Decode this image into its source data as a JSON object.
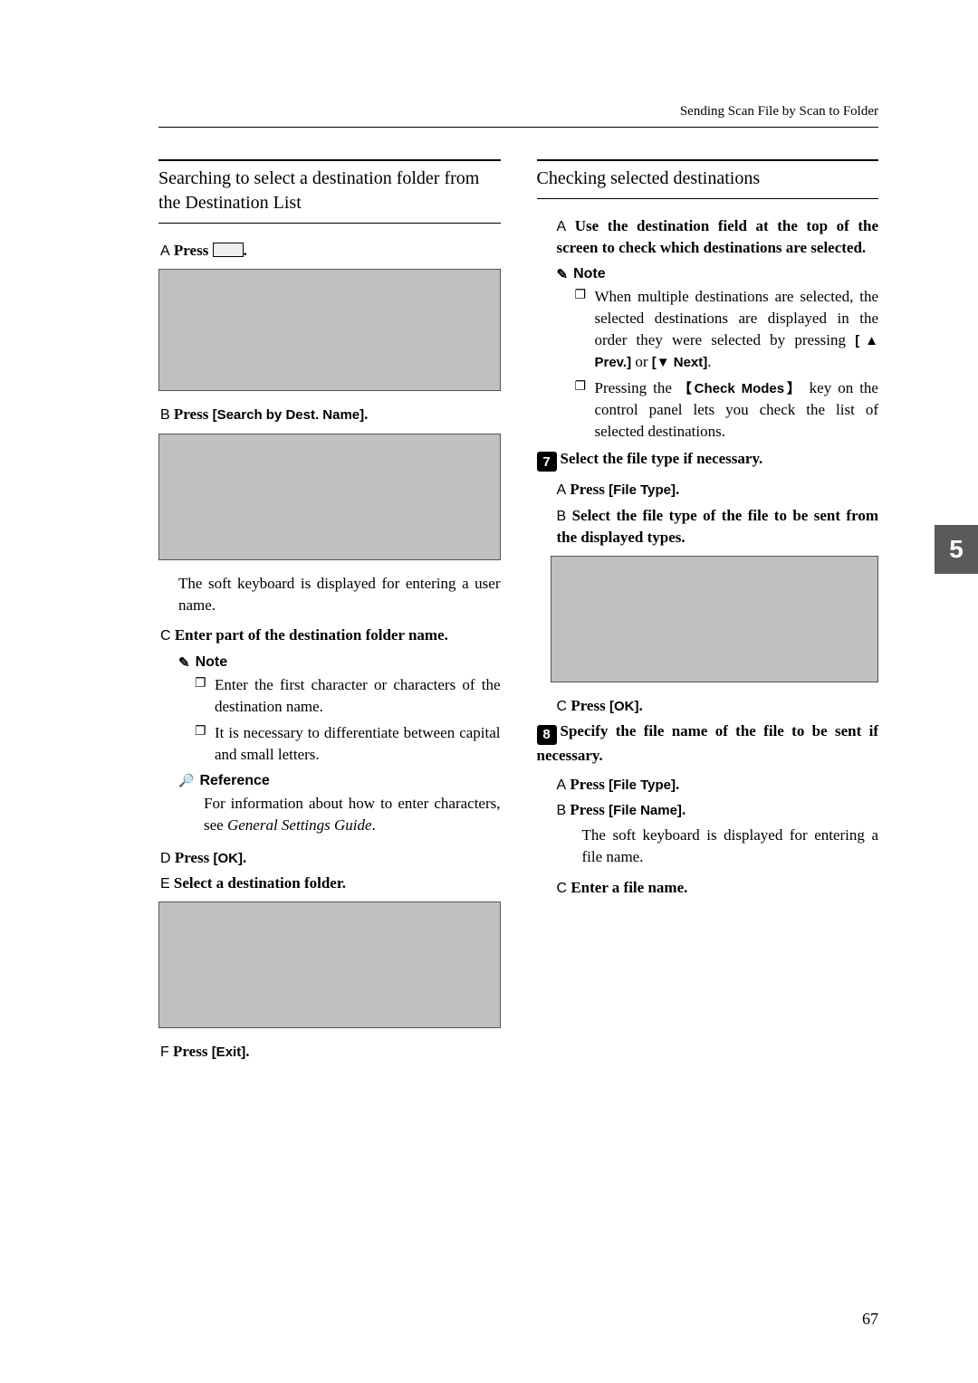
{
  "header": "Sending Scan File by Scan to Folder",
  "page_number": "67",
  "side_tab": "5",
  "left": {
    "section_title": "Searching to select a destination folder from the Destination List",
    "stepA": {
      "letter": "A",
      "text_prefix": "Press ",
      "icon_alt": "[search icon]"
    },
    "stepB": {
      "letter": "B",
      "text_prefix": "Press ",
      "button": "[Search by Dest. Name]",
      "suffix": "."
    },
    "after_b_para": "The soft keyboard is displayed for entering a user name.",
    "stepC": {
      "letter": "C",
      "text": "Enter part of the destination folder name."
    },
    "note_label": "Note",
    "note_items": [
      "Enter the first character or characters of the destination name.",
      "It is necessary to differentiate between capital and small letters."
    ],
    "ref_label": "Reference",
    "ref_body": "For information about how to enter characters, see General Settings Guide.",
    "ref_body_italic": "General Settings Guide",
    "stepD": {
      "letter": "D",
      "text_prefix": "Press ",
      "button": "[OK]",
      "suffix": "."
    },
    "stepE": {
      "letter": "E",
      "text": "Select a destination folder."
    },
    "stepF": {
      "letter": "F",
      "text_prefix": "Press ",
      "button": "[Exit]",
      "suffix": "."
    }
  },
  "right": {
    "section_title": "Checking selected destinations",
    "stepA": {
      "letter": "A",
      "text": "Use the destination field at the top of the screen to check which destinations are selected."
    },
    "note_label": "Note",
    "note_items": [
      {
        "pre": "When multiple destinations are selected, the selected destinations are displayed in the order they were selected by pressing ",
        "k1": "[▲ Prev.]",
        "mid": " or ",
        "k2": "[▼ Next]",
        "post": "."
      },
      {
        "pre": "Pressing the ",
        "k1": "【Check Modes】",
        "post": " key on the control panel lets you check the list of selected destinations."
      }
    ],
    "step7": {
      "num": "7",
      "text": "Select the file type if necessary."
    },
    "step7_A": {
      "letter": "A",
      "prefix": "Press ",
      "button": "[File Type]",
      "suffix": "."
    },
    "step7_B": {
      "letter": "B",
      "text": "Select the file type of the file to be sent from the displayed types."
    },
    "step7_C": {
      "letter": "C",
      "prefix": "Press ",
      "button": "[OK]",
      "suffix": "."
    },
    "step8": {
      "num": "8",
      "text": "Specify the file name of the file to be sent if necessary."
    },
    "step8_A": {
      "letter": "A",
      "prefix": "Press ",
      "button": "[File Type]",
      "suffix": "."
    },
    "step8_B": {
      "letter": "B",
      "prefix": "Press ",
      "button": "[File Name]",
      "suffix": "."
    },
    "step8_body": "The soft keyboard is displayed for entering a file name.",
    "step8_C": {
      "letter": "C",
      "text": "Enter a file name."
    }
  }
}
